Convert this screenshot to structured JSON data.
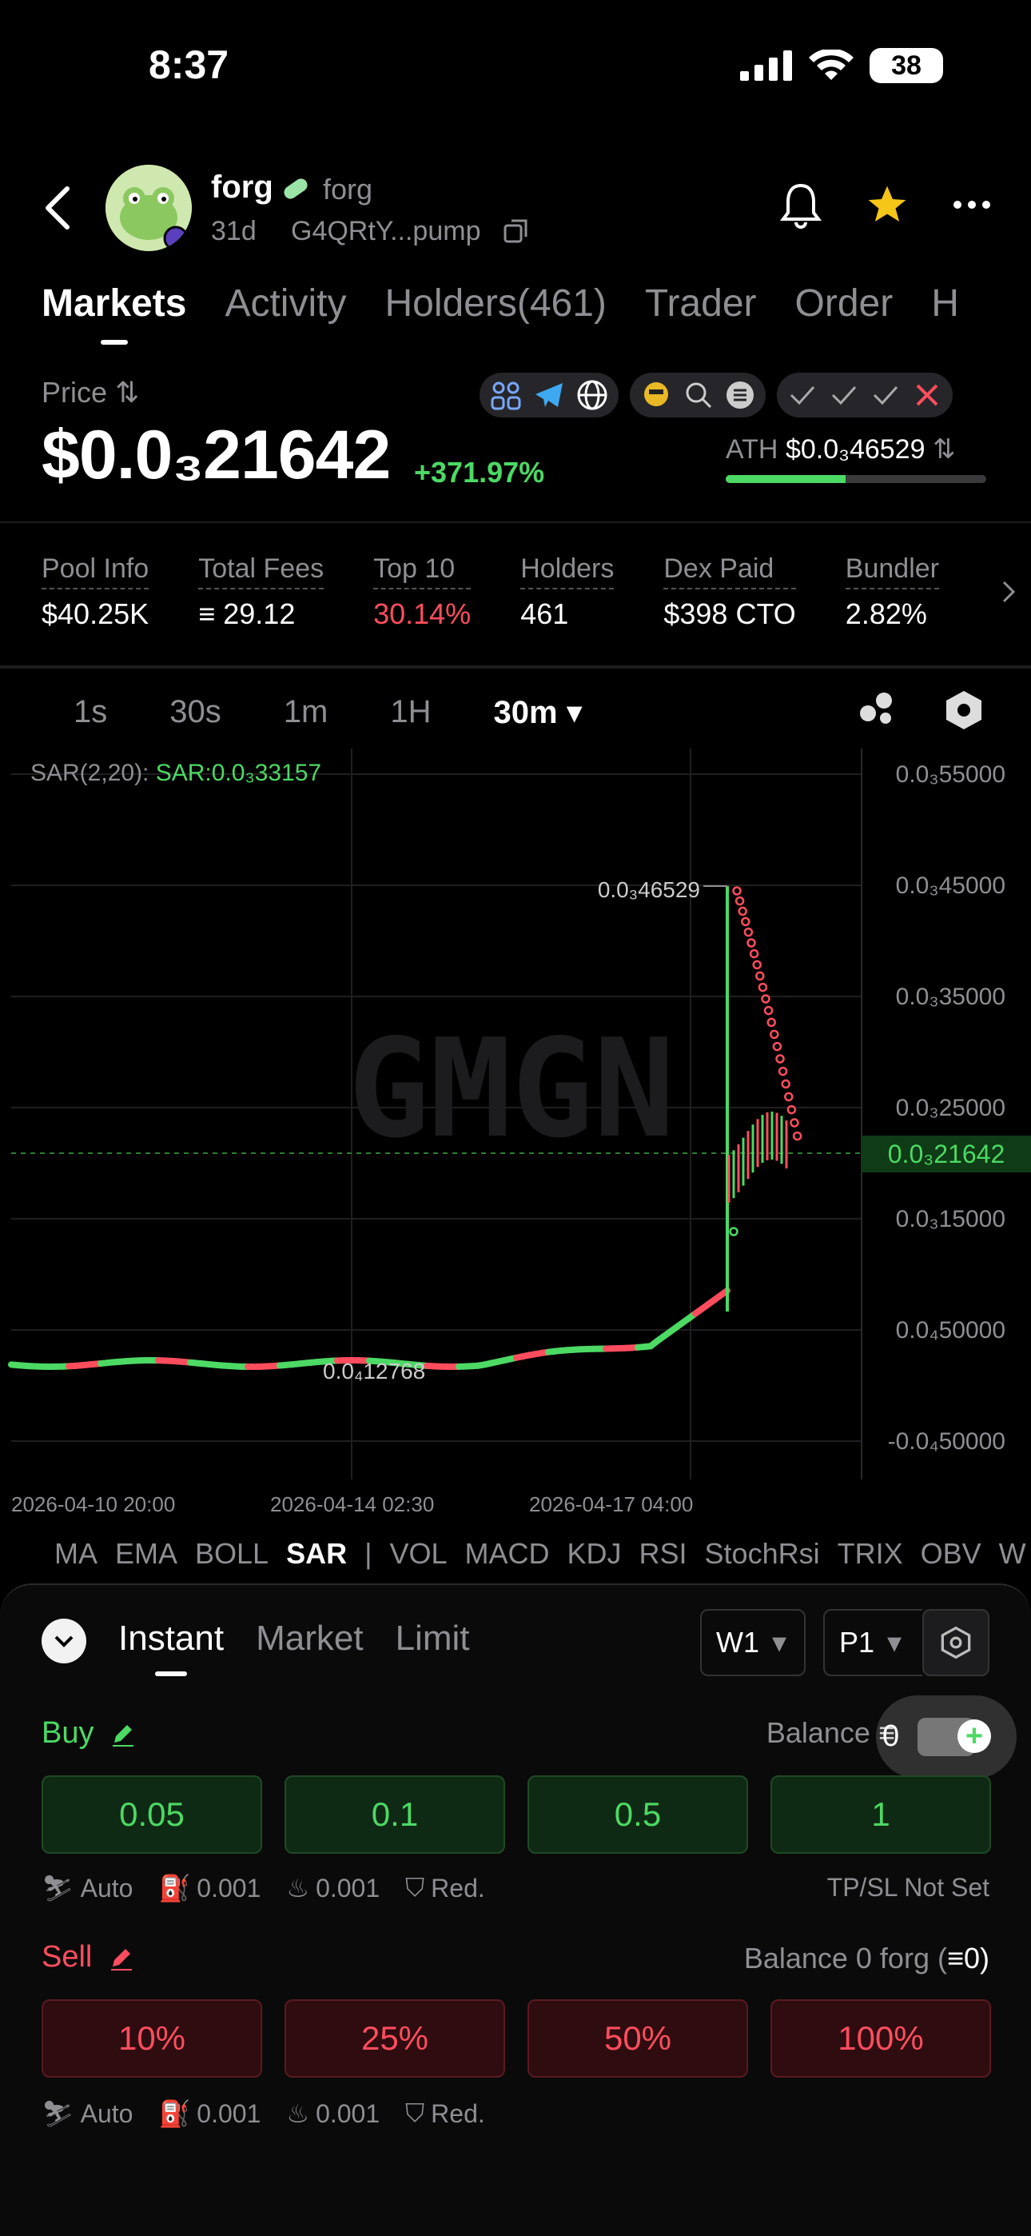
{
  "status": {
    "time": "8:37",
    "battery": "38"
  },
  "token": {
    "name": "forg",
    "symbol": "forg",
    "age": "31d",
    "address": "G4QRtY...pump"
  },
  "tabs": [
    "Markets",
    "Activity",
    "Holders(461)",
    "Trader",
    "Order",
    "H"
  ],
  "price": {
    "label": "Price",
    "value": "$0.0₃21642",
    "change": "+371.97%",
    "ath_label": "ATH",
    "ath_value": "$0.0₃46529",
    "ath_progress_pct": 46
  },
  "stats": [
    {
      "label": "Pool Info",
      "value": "$40.25K"
    },
    {
      "label": "Total Fees",
      "value": "29.12"
    },
    {
      "label": "Top 10",
      "value": "30.14%"
    },
    {
      "label": "Holders",
      "value": "461"
    },
    {
      "label": "Dex Paid",
      "value": "$398 CTO"
    },
    {
      "label": "Bundler",
      "value": "2.82%"
    }
  ],
  "timeframes": [
    "1s",
    "30s",
    "1m",
    "1H",
    "30m"
  ],
  "active_timeframe": "30m",
  "chart": {
    "sar_label": "SAR(2,20):",
    "sar_value": "SAR:0.0₃33157",
    "watermark": "GMGN",
    "y_ticks": [
      "0.0₃55000",
      "0.0₃45000",
      "0.0₃35000",
      "0.0₃25000",
      "0.0₃15000",
      "0.0₄50000",
      "-0.0₄50000"
    ],
    "current_price_tag": "0.0₃21642",
    "high_label": "0.0₃46529",
    "low_label": "0.0₄12768",
    "x_ticks": [
      "2026-04-10 20:00",
      "2026-04-14 02:30",
      "2026-04-17 04:00"
    ]
  },
  "indicators": [
    "MA",
    "EMA",
    "BOLL",
    "SAR",
    "|",
    "VOL",
    "MACD",
    "KDJ",
    "RSI",
    "StochRsi",
    "TRIX",
    "OBV",
    "W"
  ],
  "active_indicator": "SAR",
  "trade": {
    "modes": [
      "Instant",
      "Market",
      "Limit"
    ],
    "wallet": "W1",
    "preset": "P1",
    "buy_label": "Buy",
    "buy_balance": "Balance",
    "buy_balance_val": "0",
    "buy_amounts": [
      "0.05",
      "0.1",
      "0.5",
      "1"
    ],
    "sell_label": "Sell",
    "sell_balance": "Balance 0 forg (",
    "sell_balance_val": "0)",
    "sell_amounts": [
      "10%",
      "25%",
      "50%",
      "100%"
    ],
    "settings": {
      "auto": "Auto",
      "gas": "0.001",
      "fee": "0.001",
      "red": "Red."
    },
    "tpsl": "TP/SL Not Set"
  }
}
